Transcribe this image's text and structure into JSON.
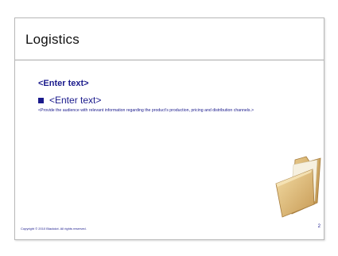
{
  "slide": {
    "title": "Logistics",
    "heading": "<Enter text>",
    "bullet_text": "<Enter text>",
    "description": "<Provide the audience with relevant information regarding the product’s production, pricing and distribution channels.>",
    "footer_copyright": "Copyright © 2010 Blackdot.  All rights reserved.",
    "page_number": "2",
    "accent_color": "#1a1a8c",
    "folder_icon": "folder-icon"
  }
}
